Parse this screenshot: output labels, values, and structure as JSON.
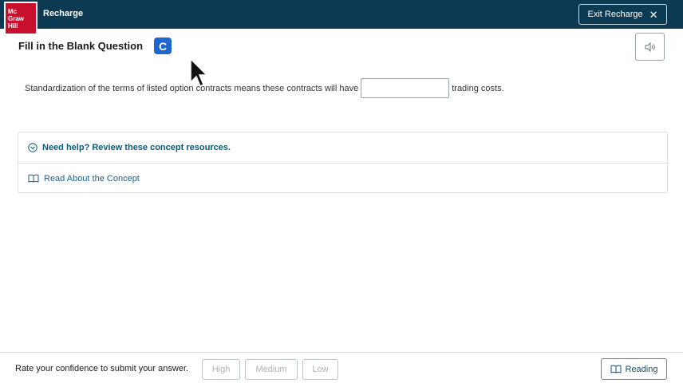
{
  "header": {
    "logo_lines": [
      "Mc",
      "Graw",
      "Hill"
    ],
    "brand": "Recharge",
    "exit_label": "Exit Recharge",
    "exit_icon": "close-icon",
    "bg_color": "#0b3a52",
    "logo_color": "#c8102e"
  },
  "question": {
    "title": "Fill in the Blank Question",
    "badge": "C",
    "badge_color": "#1e66d0",
    "audio_icon": "speaker-icon",
    "text_before": "Standardization of the terms of listed option contracts means these contracts will have",
    "blank_value": "",
    "text_after": "trading costs."
  },
  "help": {
    "heading": "Need help? Review these concept resources.",
    "heading_icon": "chevron-down-circle-icon",
    "link_label": "Read About the Concept",
    "link_icon": "book-icon"
  },
  "footer": {
    "rate_prompt": "Rate your confidence to submit your answer.",
    "confidence_options": [
      "High",
      "Medium",
      "Low"
    ],
    "reading_label": "Reading",
    "reading_icon": "book-icon"
  }
}
